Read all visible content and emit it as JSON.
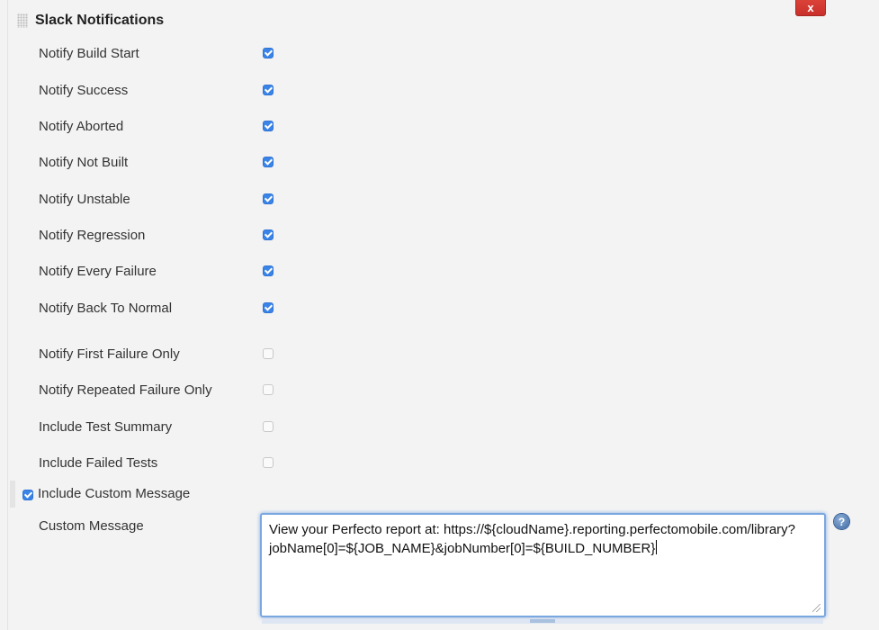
{
  "section": {
    "title": "Slack Notifications",
    "delete_label": "x"
  },
  "options": [
    {
      "label": "Notify Build Start",
      "checked": true
    },
    {
      "label": "Notify Success",
      "checked": true
    },
    {
      "label": "Notify Aborted",
      "checked": true
    },
    {
      "label": "Notify Not Built",
      "checked": true
    },
    {
      "label": "Notify Unstable",
      "checked": true
    },
    {
      "label": "Notify Regression",
      "checked": true
    },
    {
      "label": "Notify Every Failure",
      "checked": true
    },
    {
      "label": "Notify Back To Normal",
      "checked": true
    },
    {
      "label": "Notify First Failure Only",
      "checked": false
    },
    {
      "label": "Notify Repeated Failure Only",
      "checked": false
    },
    {
      "label": "Include Test Summary",
      "checked": false
    },
    {
      "label": "Include Failed Tests",
      "checked": false
    }
  ],
  "custom_message_toggle": {
    "label": "Include Custom Message",
    "checked": true
  },
  "custom_message": {
    "label": "Custom Message",
    "line1": "View your Perfecto report at: https://${cloudName}.reporting.perfectomobile.com/library?",
    "line2": "jobName[0]=${JOB_NAME}&jobNumber[0]=${BUILD_NUMBER}",
    "help": "?"
  },
  "colors": {
    "checkbox_on": "#3a84e8",
    "delete_button": "#d9534f",
    "focus_border": "#7aa7e0"
  }
}
